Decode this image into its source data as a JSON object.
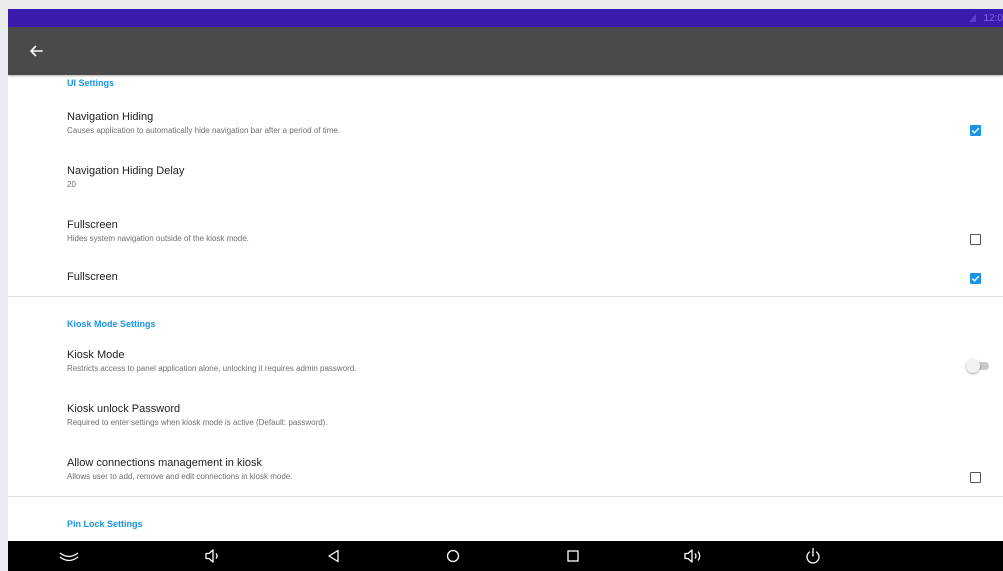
{
  "status_bar": {
    "time": "12:0",
    "color": "#3b1bab"
  },
  "toolbar": {
    "back_icon": "arrow-left-icon",
    "color": "#4a4a4a"
  },
  "accent_color": "#1a95e6",
  "sections": {
    "ui_settings": {
      "title": "UI Settings",
      "navigation_hiding": {
        "title": "Navigation Hiding",
        "summary": "Causes application to automatically hide navigation bar after a period of time.",
        "checked": true
      },
      "navigation_hiding_delay": {
        "title": "Navigation Hiding Delay",
        "value": "20"
      },
      "fullscreen_system": {
        "title": "Fullscreen",
        "summary": "Hides system navigation outside of the kiosk mode.",
        "checked": false
      },
      "fullscreen": {
        "title": "Fullscreen",
        "checked": true
      }
    },
    "kiosk_mode_settings": {
      "title": "Kiosk Mode Settings",
      "kiosk_mode": {
        "title": "Kiosk Mode",
        "summary": "Restricts access to panel application alone, unlocking it requires admin password.",
        "enabled": false
      },
      "kiosk_unlock_password": {
        "title": "Kiosk unlock Password",
        "summary": "Required to enter settings when kiosk mode is active (Default: password)."
      },
      "allow_connections_management": {
        "title": "Allow connections management in kiosk",
        "summary": "Allows user to add, remove and edit connections in kiosk mode.",
        "checked": false
      }
    },
    "pin_lock_settings": {
      "title": "Pin Lock Settings"
    }
  },
  "nav_bar": {
    "buttons": [
      "collapse-icon",
      "volume-down-icon",
      "back-triangle-icon",
      "home-circle-icon",
      "recents-square-icon",
      "volume-up-icon",
      "power-icon"
    ]
  }
}
